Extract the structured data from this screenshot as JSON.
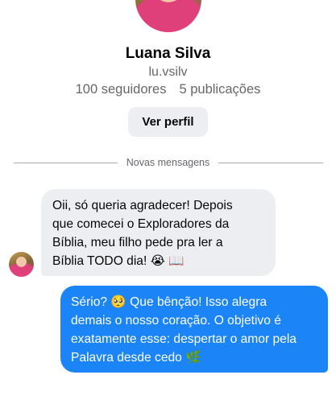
{
  "profile": {
    "name": "Luana Silva",
    "handle": "lu.vsilv",
    "followers": "100 seguidores",
    "posts": "5 publicações",
    "view_profile_label": "Ver perfil"
  },
  "divider": {
    "label": "Novas mensagens"
  },
  "messages": [
    {
      "direction": "incoming",
      "lines": [
        "Oii, só queria agradecer! Depois",
        "que comecei o Exploradores da",
        "Bíblia, meu filho pede pra ler a",
        "Bíblia TODO dia! 😭 📖"
      ]
    },
    {
      "direction": "outgoing",
      "lines": [
        "Sério? 🥺 Que bênção! Isso alegra",
        "demais o nosso coração. O objetivo é",
        "exatamente esse: despertar o amor pela",
        "Palavra desde cedo 🌿"
      ]
    }
  ],
  "colors": {
    "outgoing_bubble": "#1b84f6",
    "incoming_bubble": "#eceef1",
    "secondary_text": "#65676b"
  }
}
